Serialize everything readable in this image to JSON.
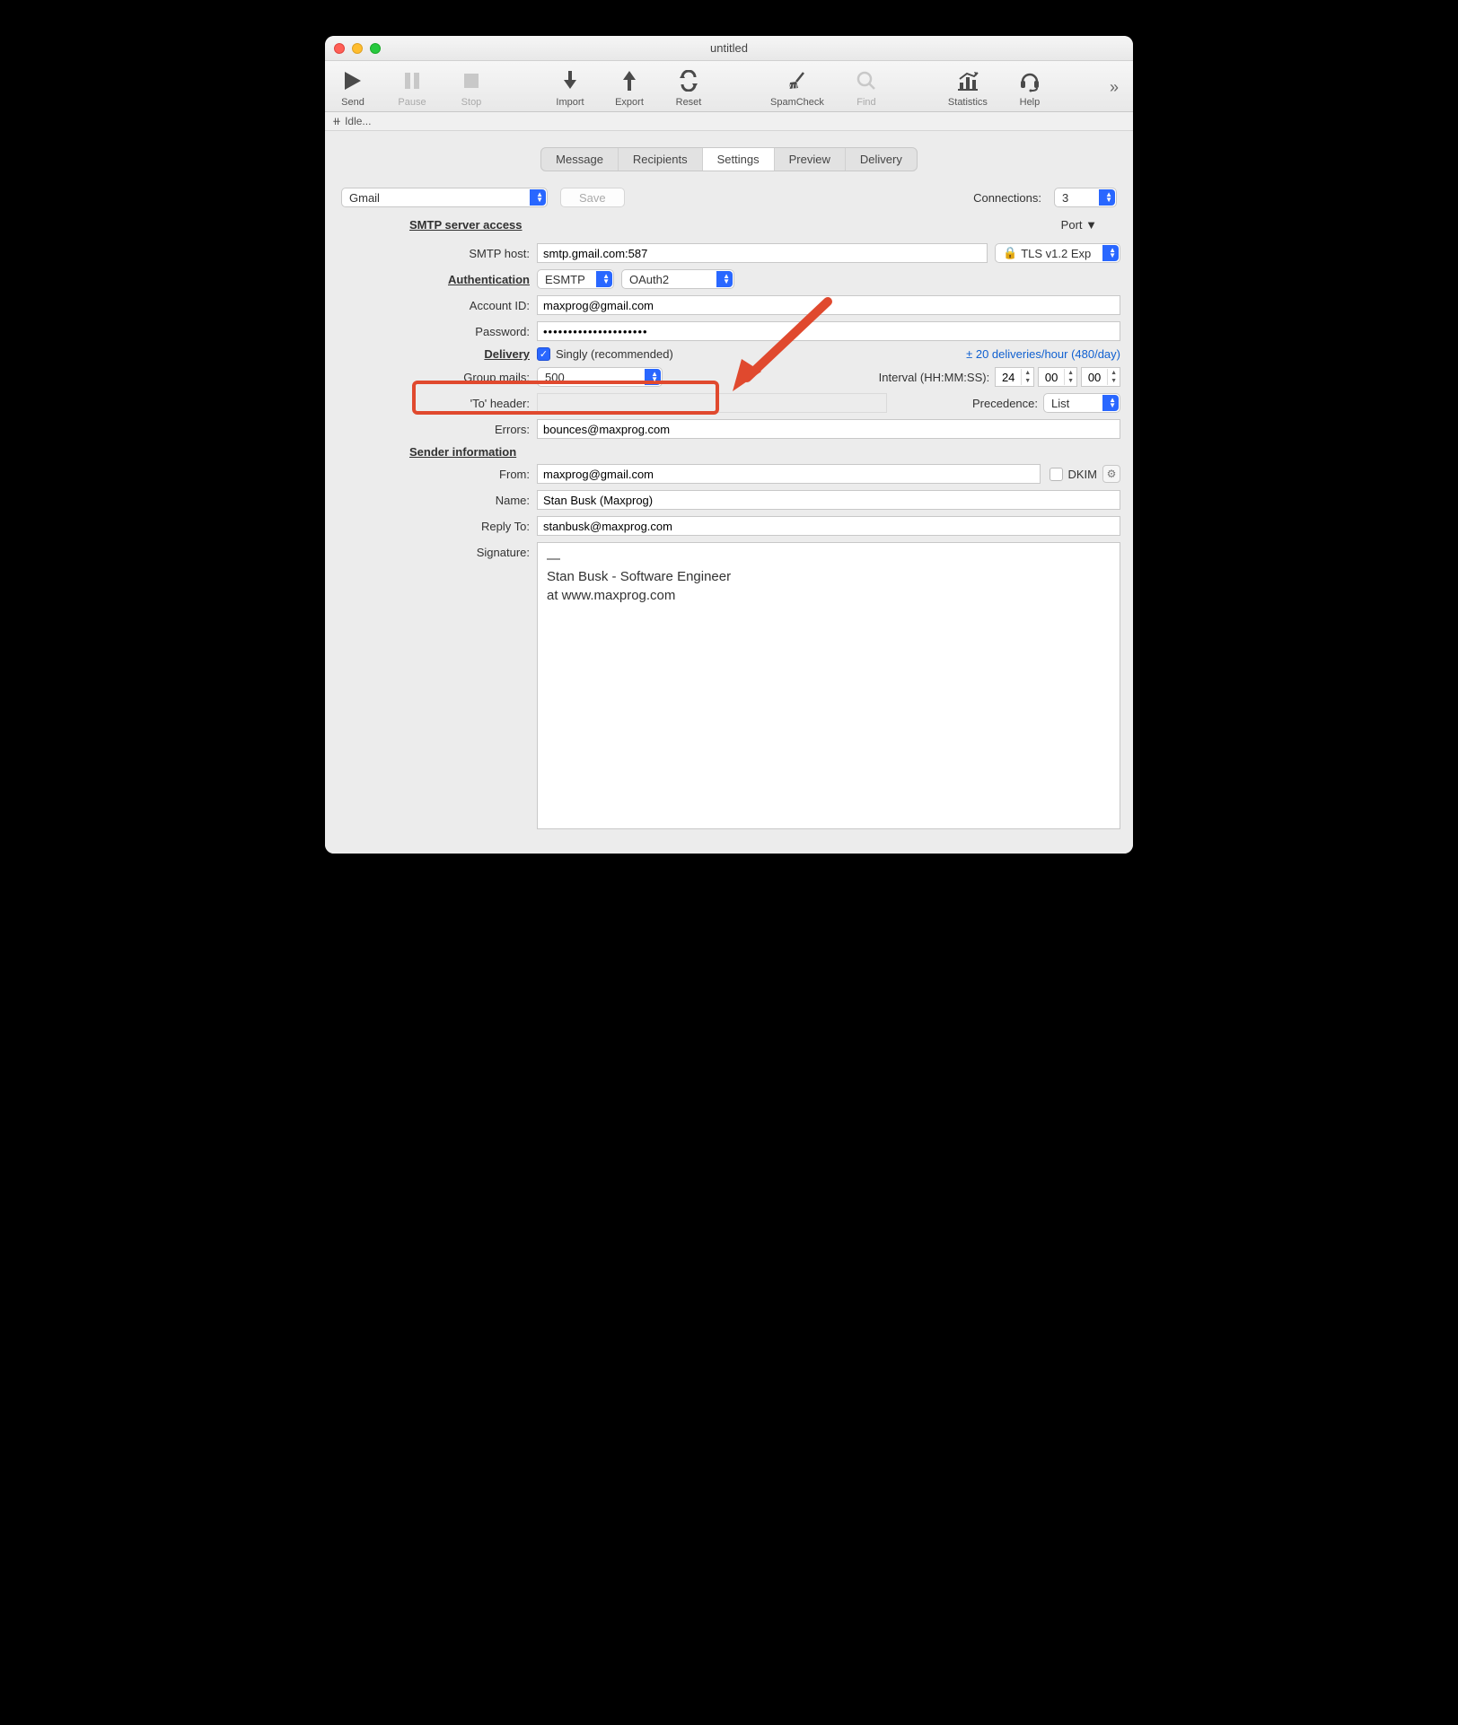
{
  "window": {
    "title": "untitled"
  },
  "toolbar": {
    "send": "Send",
    "pause": "Pause",
    "stop": "Stop",
    "import": "Import",
    "export": "Export",
    "reset": "Reset",
    "spamcheck": "SpamCheck",
    "find": "Find",
    "statistics": "Statistics",
    "help": "Help"
  },
  "status": {
    "text": "Idle..."
  },
  "tabs": {
    "message": "Message",
    "recipients": "Recipients",
    "settings": "Settings",
    "preview": "Preview",
    "delivery": "Delivery"
  },
  "top": {
    "account": "Gmail",
    "save": "Save",
    "connections_label": "Connections:",
    "connections_value": "3"
  },
  "sections": {
    "smtp_head": "SMTP server access",
    "auth_head": "Authentication",
    "delivery_head": "Delivery",
    "sender_head": "Sender information"
  },
  "labels": {
    "port": "Port ▼",
    "smtp_host": "SMTP host:",
    "account_id": "Account ID:",
    "password": "Password:",
    "singly": "Singly (recommended)",
    "group_mails": "Group mails:",
    "interval": "Interval (HH:MM:SS):",
    "to_header": "'To' header:",
    "precedence": "Precedence:",
    "errors": "Errors:",
    "from": "From:",
    "name": "Name:",
    "reply_to": "Reply To:",
    "signature": "Signature:",
    "dkim": "DKIM",
    "deliveries": "± 20 deliveries/hour (480/day)"
  },
  "values": {
    "smtp_host": "smtp.gmail.com:587",
    "tls": "TLS v1.2 Exp",
    "esmtp": "ESMTP",
    "oauth2": "OAuth2",
    "account_id": "maxprog@gmail.com",
    "password": "•••••••••••••••••••••",
    "group_mails": "500",
    "interval_hh": "24",
    "interval_mm": "00",
    "interval_ss": "00",
    "precedence": "List",
    "errors": "bounces@maxprog.com",
    "from": "maxprog@gmail.com",
    "name": "Stan Busk (Maxprog)",
    "reply_to": "stanbusk@maxprog.com",
    "sig_line1": "—",
    "sig_line2": "Stan Busk - Software Engineer",
    "sig_line3": "at www.maxprog.com"
  }
}
